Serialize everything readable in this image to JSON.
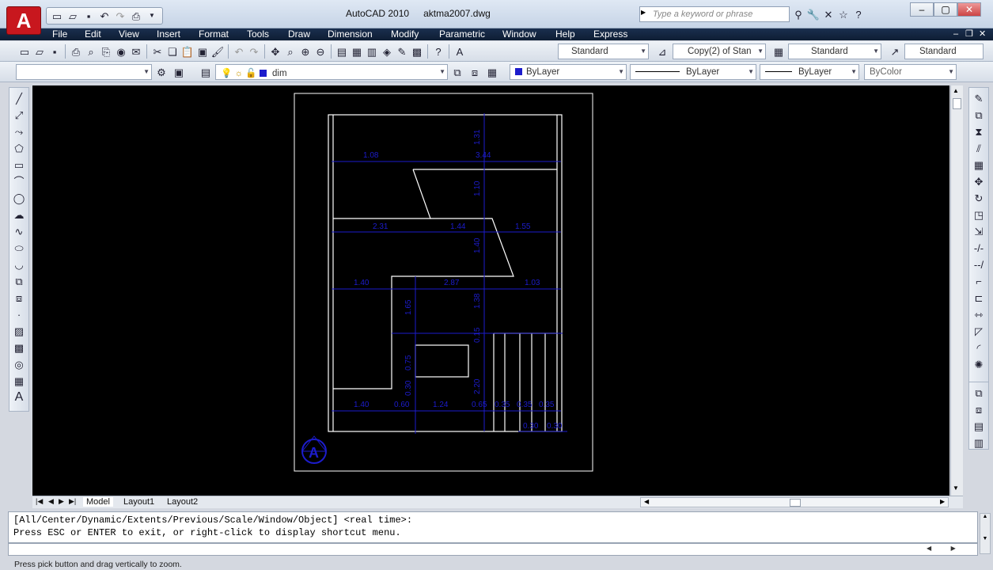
{
  "window": {
    "app_title": "AutoCAD 2010",
    "file_name": "aktma2007.dwg",
    "logo_letter": "A",
    "search_placeholder": "Type a keyword or phrase"
  },
  "menus": [
    "File",
    "Edit",
    "View",
    "Insert",
    "Format",
    "Tools",
    "Draw",
    "Dimension",
    "Modify",
    "Parametric",
    "Window",
    "Help",
    "Express"
  ],
  "toolbar_styles": {
    "text_style": "Standard",
    "dim_style": "Copy(2) of Stan",
    "table_style": "Standard",
    "mleader_style": "Standard"
  },
  "properties": {
    "layer": "dim",
    "color": "ByLayer",
    "linetype": "ByLayer",
    "lineweight": "ByLayer",
    "plotstyle": "ByColor",
    "workspace": ""
  },
  "drawing": {
    "dimensions_h": [
      "1.08",
      "3.44",
      "2.31",
      "1.44",
      "1.55",
      "1.40",
      "2.87",
      "1.03",
      "1.40",
      "0.60",
      "1.24",
      "0.65",
      "0.35",
      "0.35",
      "0.35",
      "0.30",
      "0.30"
    ],
    "dimensions_v": [
      "1.31",
      "1.10",
      "1.40",
      "1.38",
      "1.65",
      "0.15",
      "0.75",
      "0.30",
      "2.20"
    ],
    "ucs_letter": "A"
  },
  "layout_tabs": [
    "Model",
    "Layout1",
    "Layout2"
  ],
  "command_lines": [
    "[All/Center/Dynamic/Extents/Previous/Scale/Window/Object] <real time>:",
    "Press ESC or ENTER to exit, or right-click to display shortcut menu."
  ],
  "status_text": "Press pick button and drag vertically to zoom.",
  "colors": {
    "drawing_bg": "#000000",
    "dim_color": "#1c1ccc",
    "geometry": "#ffffff",
    "menubar": "#12233d"
  }
}
